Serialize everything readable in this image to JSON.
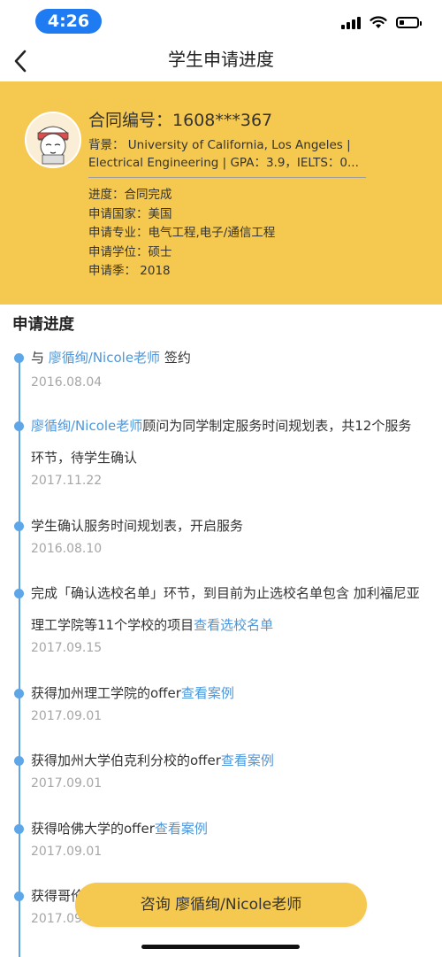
{
  "status_bar": {
    "time": "4:26"
  },
  "nav": {
    "title": "学生申请进度"
  },
  "profile": {
    "contract_label": "合同编号：",
    "contract_number": "1608***367",
    "background_line1": "背景： University of California, Los Angeles |",
    "background_line2": "Electrical Engineering | GPA：3.9，IELTS：0...",
    "progress": "进度：合同完成",
    "country": "申请国家：美国",
    "major": "申请专业：电气工程,电子/通信工程",
    "degree": "申请学位：硕士",
    "season": "申请季： 2018"
  },
  "timeline": {
    "title": "申请进度",
    "items": [
      {
        "prefix": "与 ",
        "link": "廖循绚/Nicole老师",
        "suffix": " 签约",
        "date": "2016.08.04"
      },
      {
        "prefix": "",
        "link": "廖循绚/Nicole老师",
        "suffix": "顾问为同学制定服务时间规划表，共12个服务环节，待学生确认",
        "date": "2017.11.22"
      },
      {
        "prefix": "学生确认服务时间规划表，开启服务",
        "link": "",
        "suffix": "",
        "date": "2016.08.10"
      },
      {
        "prefix": "完成「确认选校名单」环节，到目前为止选校名单包含 加利福尼亚理工学院等11个学校的项目",
        "link": "查看选校名单",
        "suffix": "",
        "date": "2017.09.15"
      },
      {
        "prefix": "获得加州理工学院的offer",
        "link": "查看案例",
        "suffix": "",
        "date": "2017.09.01"
      },
      {
        "prefix": "获得加州大学伯克利分校的offer",
        "link": "查看案例",
        "suffix": "",
        "date": "2017.09.01"
      },
      {
        "prefix": "获得哈佛大学的offer",
        "link": "查看案例",
        "suffix": "",
        "date": "2017.09.01"
      },
      {
        "prefix": "获得哥伦",
        "link": "",
        "suffix": "",
        "date": "2017.09.01"
      }
    ]
  },
  "consult_button": "咨询 廖循绚/Nicole老师"
}
